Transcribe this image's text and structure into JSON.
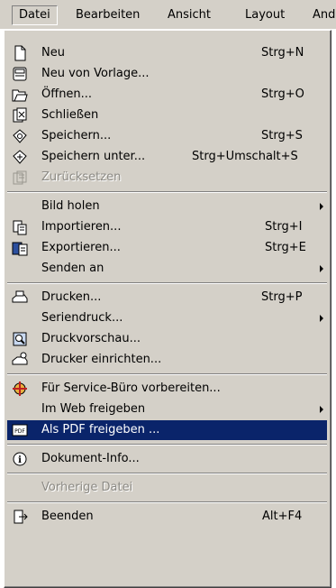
{
  "menubar": {
    "items": [
      "Datei",
      "Bearbeiten",
      "Ansicht",
      "Layout",
      "And"
    ]
  },
  "menu": {
    "items": [
      {
        "label": "Neu",
        "shortcut": "Strg+N",
        "icon": "new-document-icon"
      },
      {
        "label": "Neu von Vorlage...",
        "shortcut": "",
        "icon": "template-icon"
      },
      {
        "label": "Öffnen...",
        "shortcut": "Strg+O",
        "icon": "open-folder-icon"
      },
      {
        "label": "Schließen",
        "shortcut": "",
        "icon": "close-document-icon"
      },
      {
        "label": "Speichern...",
        "shortcut": "Strg+S",
        "icon": "save-icon"
      },
      {
        "label": "Speichern unter...",
        "shortcut": "Strg+Umschalt+S",
        "icon": "save-as-icon"
      },
      {
        "label": "Zurücksetzen",
        "shortcut": "",
        "icon": "revert-icon"
      },
      {
        "label": "Bild holen",
        "shortcut": "",
        "icon": ""
      },
      {
        "label": "Importieren...",
        "shortcut": "Strg+I",
        "icon": "import-icon"
      },
      {
        "label": "Exportieren...",
        "shortcut": "Strg+E",
        "icon": "export-icon"
      },
      {
        "label": "Senden an",
        "shortcut": "",
        "icon": ""
      },
      {
        "label": "Drucken...",
        "shortcut": "Strg+P",
        "icon": "print-icon"
      },
      {
        "label": "Seriendruck...",
        "shortcut": "",
        "icon": ""
      },
      {
        "label": "Druckvorschau...",
        "shortcut": "",
        "icon": "print-preview-icon"
      },
      {
        "label": "Drucker einrichten...",
        "shortcut": "",
        "icon": "printer-setup-icon"
      },
      {
        "label": "Für Service-Büro vorbereiten...",
        "shortcut": "",
        "icon": "service-bureau-icon"
      },
      {
        "label": "Im Web freigeben",
        "shortcut": "",
        "icon": ""
      },
      {
        "label": "Als PDF freigeben ...",
        "shortcut": "",
        "icon": "pdf-icon"
      },
      {
        "label": "Dokument-Info...",
        "shortcut": "",
        "icon": "info-icon"
      },
      {
        "label": "Vorherige Datei",
        "shortcut": "",
        "icon": ""
      },
      {
        "label": "Beenden",
        "shortcut": "Alt+F4",
        "icon": "exit-icon"
      }
    ]
  },
  "colors": {
    "menu_bg": "#d4d0c8",
    "highlight": "#0a246a",
    "disabled_text": "#8c8a84"
  }
}
